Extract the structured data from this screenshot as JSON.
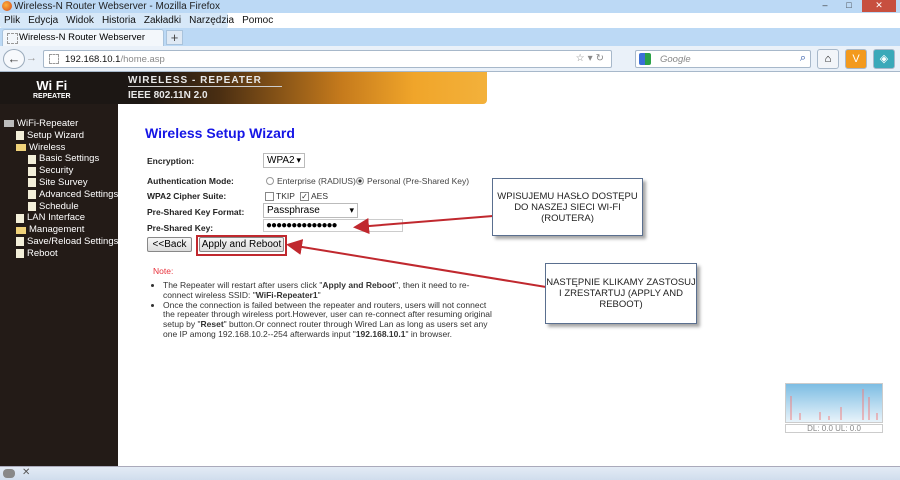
{
  "window": {
    "title": "Wireless-N Router Webserver - Mozilla Firefox"
  },
  "menu": [
    "Plik",
    "Edycja",
    "Widok",
    "Historia",
    "Zakładki",
    "Narzędzia",
    "Pomoc"
  ],
  "tab": {
    "label": "Wireless-N Router Webserver",
    "new_tab": "+"
  },
  "url": {
    "host": "192.168.10.1",
    "path": "/home.asp"
  },
  "search": {
    "placeholder": "Google"
  },
  "banner": {
    "logo": "Wi Fi",
    "logo_sub": "REPEATER",
    "line1": "WIRELESS - REPEATER",
    "line2": "IEEE 802.11N 2.0"
  },
  "sidebar": {
    "root": "WiFi-Repeater",
    "items": [
      "Setup Wizard",
      "Wireless",
      "Basic Settings",
      "Security",
      "Site Survey",
      "Advanced Settings",
      "Schedule",
      "LAN Interface",
      "Management",
      "Save/Reload Settings",
      "Reboot"
    ]
  },
  "form": {
    "title": "Wireless Setup Wizard",
    "encryption_label": "Encryption:",
    "encryption_value": "WPA2",
    "auth_label": "Authentication Mode:",
    "auth_enterprise": "Enterprise (RADIUS)",
    "auth_personal": "Personal (Pre-Shared Key)",
    "cipher_label": "WPA2 Cipher Suite:",
    "tkip": "TKIP",
    "aes": "AES",
    "format_label": "Pre-Shared Key Format:",
    "format_value": "Passphrase",
    "key_label": "Pre-Shared Key:",
    "key_value": "●●●●●●●●●●●●●●",
    "back": "<<Back",
    "apply": "Apply and Reboot"
  },
  "note": {
    "label": "Note:",
    "b1a": "The Repeater will restart after users click \"",
    "b1b": "Apply and Reboot",
    "b1c": "\", then it need to re-connect wireless SSID: \"",
    "b1d": "WiFi-Repeater1",
    "b1e": "\"",
    "b2a": "Once the connection is failed between the repeater and routers, users will not connect the repeater through wireless port.However, user can re-connect after resuming original setup by \"",
    "b2b": "Reset",
    "b2c": "\" button.Or connect router through Wired Lan as long as users set any one IP among 192.168.10.2--254 afterwards input \"",
    "b2d": "192.168.10.1",
    "b2e": "\" in browser."
  },
  "callouts": [
    "WPISUJEMU HASŁO DOSTĘPU DO NASZEJ SIECI WI-FI (ROUTERA)",
    "NASTĘPNIE KLIKAMY ZASTOSUJ I ZRESTARTUJ (APPLY AND REBOOT)"
  ],
  "traffic": {
    "label": "DL: 0.0 UL: 0.0"
  },
  "colors": {
    "title": "#1515e6",
    "note": "#e8303a",
    "annotation": "#c0282e"
  }
}
